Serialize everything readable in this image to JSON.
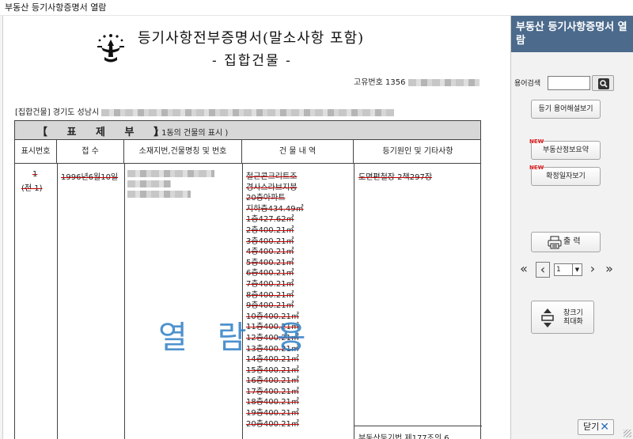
{
  "window": {
    "title": "부동산 등기사항증명서 열람"
  },
  "document": {
    "title": "등기사항전부증명서(말소사항 포함)",
    "subtitle": "- 집합건물 -",
    "unique_no_label": "고유번호 1356",
    "address_prefix": "[집합건물]  경기도 성남시",
    "section_title": "【 표 제 부 】",
    "section_sub": "( 1동의 건물의 표시 )",
    "columns": [
      "표시번호",
      "접  수",
      "소재지번,건물명칭 및 번호",
      "건 물 내 역",
      "등기원인 및 기타사항"
    ],
    "row": {
      "display_no": "1",
      "display_no_sub": "(전 1)",
      "received": "1996년6월10일",
      "building_details": [
        "철근콘크리트조",
        "경사스라브지붕",
        "20층아파트",
        "지하층434.49㎡",
        "1층427.62㎡",
        "2층400.21㎡",
        "3층400.21㎡",
        "4층400.21㎡",
        "5층400.21㎡",
        "6층400.21㎡",
        "7층400.21㎡",
        "8층400.21㎡",
        "9층400.21㎡",
        "10층400.21㎡",
        "11층400.21㎡",
        "12층400.21㎡",
        "13층400.21㎡",
        "14층400.21㎡",
        "15층400.21㎡",
        "16층400.21㎡",
        "17층400.21㎡",
        "18층400.21㎡",
        "19층400.21㎡",
        "20층400.21㎡"
      ],
      "cause": "도면편철장 2책297장",
      "next_cause": "부동산등기법 제177조의 6"
    },
    "watermark": "열람용"
  },
  "panel": {
    "title": "부동산 등기사항증명서 열람",
    "search_label": "용어검색",
    "search_value": "",
    "glossary_button": "등기 용어해설보기",
    "new_badge": "NEW",
    "summary_button": "부동산정보요약",
    "date_button": "확정일자보기",
    "print_button": "출 력",
    "page_value": "1",
    "maximize_label_1": "창크기",
    "maximize_label_2": "최대화",
    "close_button": "닫기",
    "accent_color": "#4b6a8c"
  }
}
